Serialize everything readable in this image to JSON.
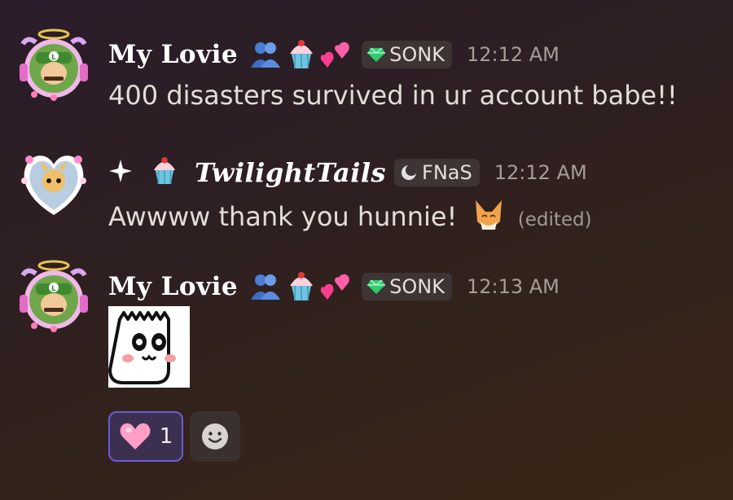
{
  "messages": [
    {
      "author": "My Lovie",
      "author_emojis": [
        "people-hugging-emoji",
        "cupcake-emoji",
        "two-hearts-emoji"
      ],
      "tag": {
        "icon": "gem-icon",
        "label": "SONK"
      },
      "time": "12:12 AM",
      "text": "400 disasters survived in ur account babe!!"
    },
    {
      "prefix_emojis": [
        "sparkle-emoji",
        "cupcake-emoji"
      ],
      "author": "TwilightTails",
      "tag": {
        "icon": "moon-icon",
        "label": "FNaS"
      },
      "time": "12:12 AM",
      "text": "Awwww thank you hunnie!",
      "inline_emoji": "fox-face-emoji",
      "edited": "(edited)"
    },
    {
      "author": "My Lovie",
      "author_emojis": [
        "people-hugging-emoji",
        "cupcake-emoji",
        "two-hearts-emoji"
      ],
      "tag": {
        "icon": "gem-icon",
        "label": "SONK"
      },
      "time": "12:13 AM",
      "sticker": "blushing-bag-sticker",
      "reactions": [
        {
          "emoji": "pink-heart-emoji",
          "count": "1"
        }
      ],
      "add_reaction_icon": "smiley-add-icon"
    }
  ],
  "colors": {
    "accent_reaction_border": "#6a5cd8",
    "tag_bg": "#3e3433",
    "timestamp": "#a59e98"
  }
}
